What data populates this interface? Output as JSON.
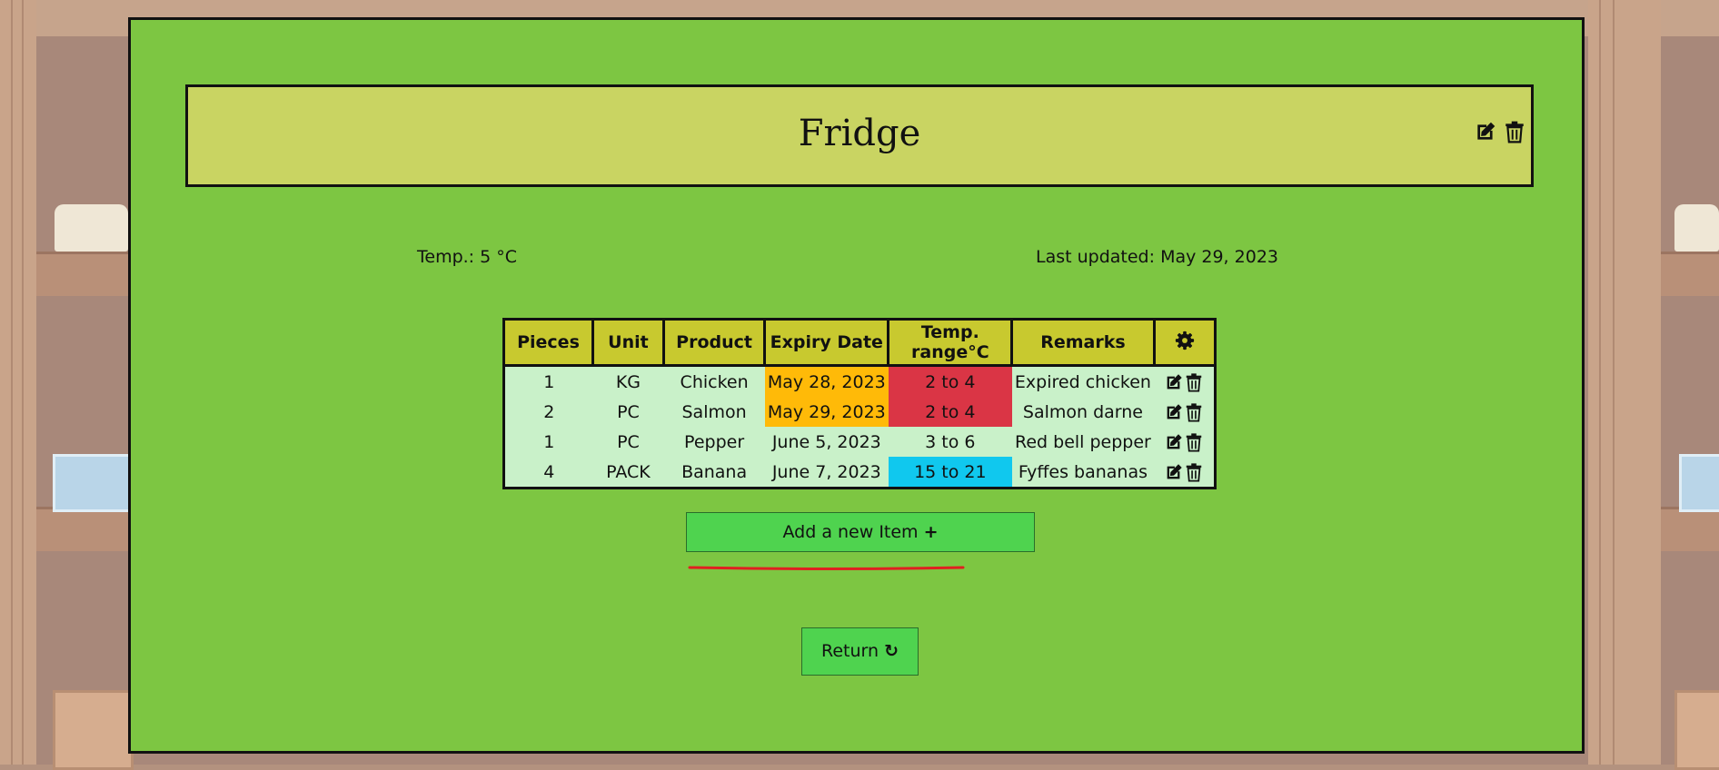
{
  "fridge": {
    "title": "Fridge",
    "temperature": "Temp.: 5 °C",
    "last_updated": "Last updated: May 29, 2023"
  },
  "table": {
    "headers": [
      "Pieces",
      "Unit",
      "Product",
      "Expiry Date",
      "Temp. range°C",
      "Remarks"
    ],
    "settings_header_icon": "gear-icon",
    "rows": [
      {
        "pieces": "1",
        "unit": "KG",
        "product": "Chicken",
        "expiry": "May 28, 2023",
        "temp_range": "2 to 4",
        "remarks": "Expired chicken",
        "expiry_status": "warning",
        "temp_status": "danger"
      },
      {
        "pieces": "2",
        "unit": "PC",
        "product": "Salmon",
        "expiry": "May 29, 2023",
        "temp_range": "2 to 4",
        "remarks": "Salmon darne",
        "expiry_status": "warning",
        "temp_status": "danger"
      },
      {
        "pieces": "1",
        "unit": "PC",
        "product": "Pepper",
        "expiry": "June 5, 2023",
        "temp_range": "3 to 6",
        "remarks": "Red bell pepper",
        "expiry_status": "ok",
        "temp_status": "ok"
      },
      {
        "pieces": "4",
        "unit": "PACK",
        "product": "Banana",
        "expiry": "June 7, 2023",
        "temp_range": "15 to 21",
        "remarks": "Fyffes bananas",
        "expiry_status": "ok",
        "temp_status": "info"
      }
    ]
  },
  "buttons": {
    "add_label": "Add a new Item",
    "add_icon": "plus-icon",
    "return_label": "Return",
    "return_icon": "undo-icon"
  },
  "icons": {
    "edit": "edit-icon",
    "delete": "trash-icon"
  },
  "colors": {
    "panel": "#7dc642",
    "header": "#c9d462",
    "table_header": "#c8c92f",
    "table_body": "#c9f1c9",
    "warning": "#ffba08",
    "danger": "#da3545",
    "info": "#10c8ee",
    "button": "#4fd34f",
    "annotation": "#e02020"
  }
}
